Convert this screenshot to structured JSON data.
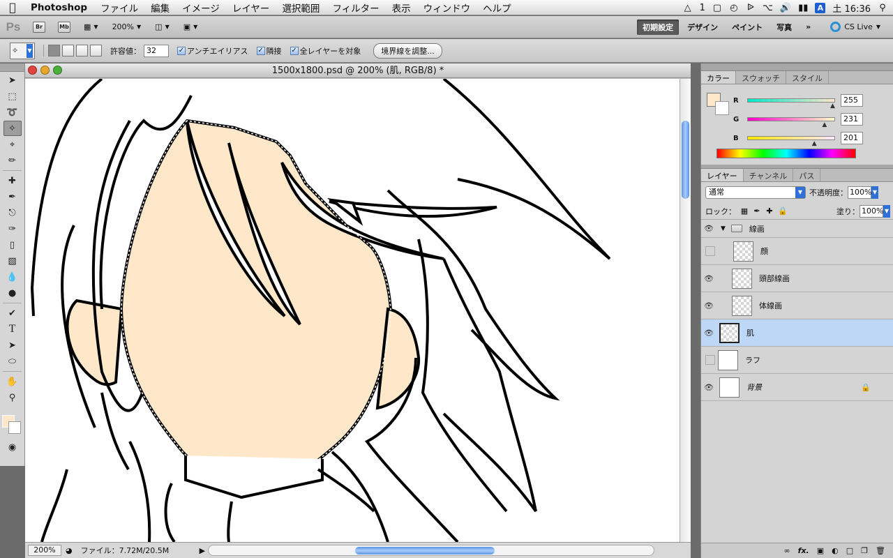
{
  "menubar": {
    "app": "Photoshop",
    "items": [
      "ファイル",
      "編集",
      "イメージ",
      "レイヤー",
      "選択範囲",
      "フィルター",
      "表示",
      "ウィンドウ",
      "ヘルプ"
    ],
    "status_text": "1",
    "clock": "土 16:36",
    "ime": "A"
  },
  "appbar": {
    "logo": "Ps",
    "bridge": "Br",
    "mini_bridge": "Mb",
    "zoom": "200%",
    "workspaces": [
      "初期設定",
      "デザイン",
      "ペイント",
      "写真"
    ],
    "more": "»",
    "cs_live": "CS Live"
  },
  "options": {
    "tolerance_label": "許容値：",
    "tolerance_value": "32",
    "antialias": "アンチエイリアス",
    "contiguous": "隣接",
    "sample_all": "全レイヤーを対象",
    "refine_edge": "境界線を調整..."
  },
  "document": {
    "title": "1500x1800.psd @ 200% (肌, RGB/8) *",
    "zoom": "200%",
    "file_info": "ファイル：7.72M/20.5M"
  },
  "color_panel": {
    "tabs": [
      "カラー",
      "スウォッチ",
      "スタイル"
    ],
    "fg_color": "#ffe7c9",
    "channels": [
      {
        "label": "R",
        "value": "255",
        "level": 1.0
      },
      {
        "label": "G",
        "value": "231",
        "level": 0.906
      },
      {
        "label": "B",
        "value": "201",
        "level": 0.788
      }
    ]
  },
  "layers_panel": {
    "tabs": [
      "レイヤー",
      "チャンネル",
      "パス"
    ],
    "blend_mode": "通常",
    "opacity_label": "不透明度：",
    "opacity": "100%",
    "lock_label": "ロック：",
    "fill_label": "塗り：",
    "fill": "100%",
    "group": "線画",
    "layers": [
      {
        "name": "顔",
        "visible": false
      },
      {
        "name": "頭部線画",
        "visible": true
      },
      {
        "name": "体線画",
        "visible": true
      },
      {
        "name": "肌",
        "visible": true
      },
      {
        "name": "ラフ",
        "visible": false
      },
      {
        "name": "背景",
        "visible": true
      }
    ]
  },
  "colors": {
    "skin": "#ffe7c9",
    "selection_blue": "#bfd7f7",
    "accent": "#2f6fd8"
  }
}
